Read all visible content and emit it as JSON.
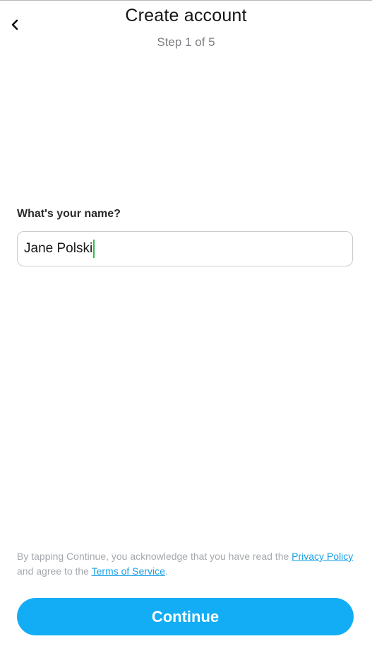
{
  "header": {
    "title": "Create account",
    "step": "Step 1 of 5",
    "back_icon": "chevron-left-icon"
  },
  "form": {
    "name_label": "What's your name?",
    "name_value": "Jane Polski"
  },
  "legal": {
    "text_before": "By tapping Continue, you acknowledge that you have read the ",
    "privacy_link": "Privacy Policy",
    "text_middle": " and agree to the ",
    "terms_link": "Terms of Service",
    "text_after": "."
  },
  "actions": {
    "continue_label": "Continue"
  },
  "colors": {
    "accent": "#13adf5",
    "link": "#1aa0e6",
    "caret": "#2fbf4a",
    "muted_text": "#a4a8ad"
  }
}
